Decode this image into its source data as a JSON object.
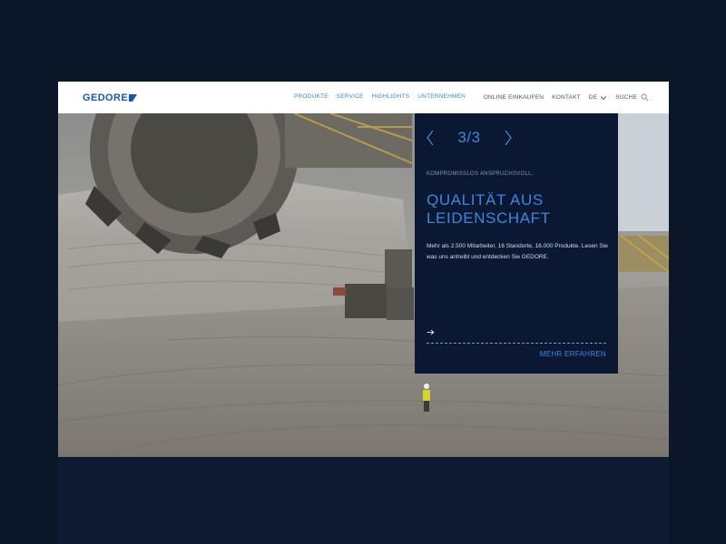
{
  "brand": {
    "logo_text": "GEDORE",
    "brand_color": "#1957a6",
    "accent": "#3f86d9"
  },
  "nav": {
    "main": [
      {
        "label": "PRODUKTE"
      },
      {
        "label": "SERVICE"
      },
      {
        "label": "HIGHLIGHTS"
      },
      {
        "label": "UNTERNEHMEN"
      }
    ],
    "right": {
      "shop": "ONLINE EINKAUFEN",
      "contact": "KONTAKT",
      "language": "DE",
      "search": "SUCHE"
    }
  },
  "slider": {
    "counter": "3/3",
    "prev_icon": "chevron-left-icon",
    "next_icon": "chevron-right-icon",
    "kicker": "KOMPROMISSLOS ANSPRUCHSVOLL.",
    "headline": "QUALITÄT AUS LEIDENSCHAFT",
    "body": "Mehr als 2.500 Mitarbeiter, 16 Standorte, 16.000 Produkte. Lesen Sie was uns antreibt und entdecken Sie GEDORE.",
    "arrow_icon": "arrow-right-icon",
    "more_label": "MEHR ERFAHREN"
  },
  "hero_image": {
    "icon": "mining-bucket-wheel-excavator-photo"
  }
}
